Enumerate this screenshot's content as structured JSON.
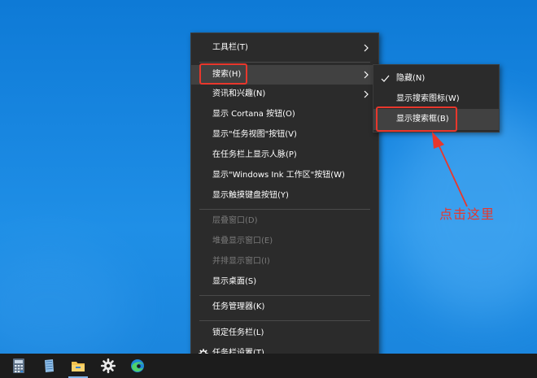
{
  "context_menu": {
    "items": [
      {
        "label": "工具栏(T)",
        "has_submenu": true
      },
      {
        "label": "搜索(H)",
        "has_submenu": true,
        "highlighted": true
      },
      {
        "label": "资讯和兴趣(N)",
        "has_submenu": true
      },
      {
        "label": "显示 Cortana 按钮(O)"
      },
      {
        "label": "显示\"任务视图\"按钮(V)"
      },
      {
        "label": "在任务栏上显示人脉(P)"
      },
      {
        "label": "显示\"Windows Ink 工作区\"按钮(W)"
      },
      {
        "label": "显示触摸键盘按钮(Y)"
      },
      {
        "label": "层叠窗口(D)",
        "disabled": true
      },
      {
        "label": "堆叠显示窗口(E)",
        "disabled": true
      },
      {
        "label": "并排显示窗口(I)",
        "disabled": true
      },
      {
        "label": "显示桌面(S)"
      },
      {
        "label": "任务管理器(K)"
      },
      {
        "label": "锁定任务栏(L)"
      },
      {
        "label": "任务栏设置(T)",
        "icon": "gear-icon"
      }
    ]
  },
  "submenu": {
    "items": [
      {
        "label": "隐藏(N)",
        "checked": true
      },
      {
        "label": "显示搜索图标(W)"
      },
      {
        "label": "显示搜索框(B)",
        "highlighted": true
      }
    ]
  },
  "annotation": {
    "text": "点击这里",
    "color": "#e8372c"
  },
  "taskbar": {
    "icons": [
      "calculator-icon",
      "notepad-icon",
      "file-explorer-icon",
      "settings-gear-icon",
      "edge-browser-icon"
    ]
  },
  "colors": {
    "menu_bg": "#2b2b2b",
    "menu_hover": "#414141",
    "disabled_text": "#7a7a7a",
    "highlight_red": "#e8372c",
    "desktop_blue": "#1a84dc",
    "taskbar_bg": "#1c1c1c"
  }
}
